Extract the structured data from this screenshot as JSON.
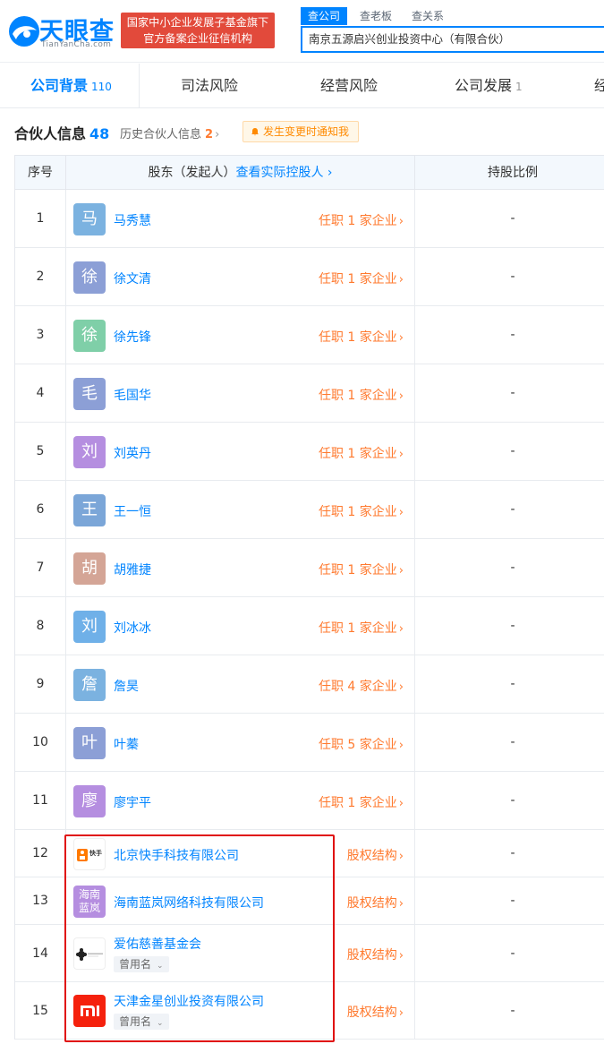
{
  "header": {
    "logo_text": "天眼查",
    "logo_sub": "TianYanCha.com",
    "gov_line1": "国家中小企业发展子基金旗下",
    "gov_line2": "官方备案企业征信机构",
    "search_tabs": [
      "查公司",
      "查老板",
      "查关系"
    ],
    "search_value": "南京五源启兴创业投资中心（有限合伙）"
  },
  "nav": {
    "tabs": [
      {
        "label": "公司背景",
        "count": "110"
      },
      {
        "label": "司法风险",
        "count": ""
      },
      {
        "label": "经营风险",
        "count": ""
      },
      {
        "label": "公司发展",
        "count": "1"
      },
      {
        "label": "经",
        "count": ""
      }
    ]
  },
  "section": {
    "title": "合伙人信息",
    "count": "48",
    "history_label": "历史合伙人信息",
    "history_count": "2",
    "notify_label": "发生变更时通知我"
  },
  "table": {
    "col_no": "序号",
    "col_holder": "股东（发起人）",
    "col_holder_link": "查看实际控股人",
    "col_pct": "持股比例",
    "rows": [
      {
        "no": "1",
        "avatar": "马",
        "color": "#7bb2e0",
        "name": "马秀慧",
        "link": "任职 1 家企业",
        "pct": "-"
      },
      {
        "no": "2",
        "avatar": "徐",
        "color": "#8c9fd6",
        "name": "徐文清",
        "link": "任职 1 家企业",
        "pct": "-"
      },
      {
        "no": "3",
        "avatar": "徐",
        "color": "#7fcfa8",
        "name": "徐先锋",
        "link": "任职 1 家企业",
        "pct": "-"
      },
      {
        "no": "4",
        "avatar": "毛",
        "color": "#8c9fd6",
        "name": "毛国华",
        "link": "任职 1 家企业",
        "pct": "-"
      },
      {
        "no": "5",
        "avatar": "刘",
        "color": "#b58ee0",
        "name": "刘英丹",
        "link": "任职 1 家企业",
        "pct": "-"
      },
      {
        "no": "6",
        "avatar": "王",
        "color": "#7ba6d8",
        "name": "王一恒",
        "link": "任职 1 家企业",
        "pct": "-"
      },
      {
        "no": "7",
        "avatar": "胡",
        "color": "#d4a596",
        "name": "胡雅捷",
        "link": "任职 1 家企业",
        "pct": "-"
      },
      {
        "no": "8",
        "avatar": "刘",
        "color": "#6fb0e8",
        "name": "刘冰冰",
        "link": "任职 1 家企业",
        "pct": "-"
      },
      {
        "no": "9",
        "avatar": "詹",
        "color": "#7bb2e0",
        "name": "詹昊",
        "link": "任职 4 家企业",
        "pct": "-"
      },
      {
        "no": "10",
        "avatar": "叶",
        "color": "#8c9fd6",
        "name": "叶蓁",
        "link": "任职 5 家企业",
        "pct": "-"
      },
      {
        "no": "11",
        "avatar": "廖",
        "color": "#b58ee0",
        "name": "廖宇平",
        "link": "任职 1 家企业",
        "pct": "-"
      }
    ],
    "company_rows": [
      {
        "no": "12",
        "logo": "kuaishou-logo",
        "logo_text": "快手",
        "name": "北京快手科技有限公司",
        "link": "股权结构",
        "pct": "-",
        "former": ""
      },
      {
        "no": "13",
        "logo": "lanlan-logo",
        "logo_text": "海南蓝岚",
        "color": "#b58ee0",
        "name": "海南蓝岚网络科技有限公司",
        "link": "股权结构",
        "pct": "-",
        "former": ""
      },
      {
        "no": "14",
        "logo": "foundation-logo",
        "name": "爱佑慈善基金会",
        "link": "股权结构",
        "pct": "-",
        "former": "曾用名"
      },
      {
        "no": "15",
        "logo": "mi-logo",
        "color": "#f5210d",
        "name": "天津金星创业投资有限公司",
        "link": "股权结构",
        "pct": "-",
        "former": "曾用名"
      }
    ]
  },
  "colors": {
    "brand": "#0084ff",
    "accent_orange": "#ff7a2f",
    "gov_red": "#e24a3b",
    "highlight_red": "#e01010"
  }
}
